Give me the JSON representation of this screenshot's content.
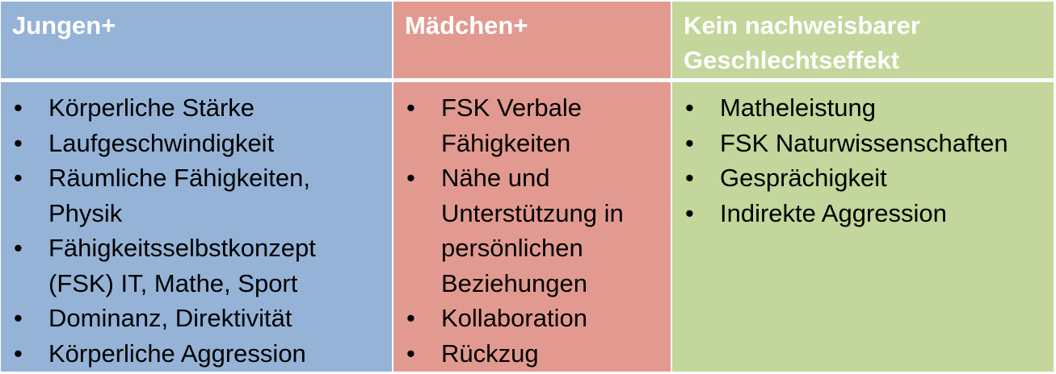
{
  "columns": [
    {
      "header": "Jungen+",
      "color": "#95b3d7",
      "items": [
        "Körperliche Stärke",
        "Laufgeschwindigkeit",
        "Räumliche Fähigkeiten, Physik",
        "Fähigkeitsselbstkonzept (FSK) IT, Mathe, Sport",
        "Dominanz, Direktivität",
        "Körperliche Aggression"
      ]
    },
    {
      "header": "Mädchen+",
      "color": "#e29a90",
      "items": [
        "FSK Verbale Fähigkeiten",
        "Nähe und Unterstützung in persönlichen Beziehungen",
        "Kollaboration",
        "Rückzug"
      ]
    },
    {
      "header": "Kein nachweisbarer Geschlechtseffekt",
      "color": "#c3d69b",
      "items": [
        "Matheleistung",
        "FSK Naturwissenschaften",
        "Gesprächigkeit",
        "Indirekte Aggression"
      ]
    }
  ],
  "bullet": "•"
}
